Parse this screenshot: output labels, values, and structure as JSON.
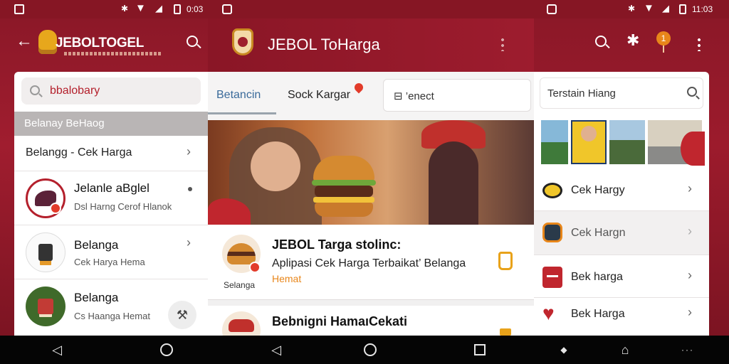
{
  "status": {
    "left_time": "0:03",
    "right_time": "11:03"
  },
  "left": {
    "app_title": "JEBOLTOGEL",
    "search_text": "bbalobary",
    "section_header": "Belanay BeHaog",
    "menu_row": "Belangg - Cek Harga",
    "items": [
      {
        "title": "Jelanle aBglel",
        "subtitle": "Dsl Harng Cerof Hlanok"
      },
      {
        "title": "Belanga",
        "subtitle": "Cek Harya Hema"
      },
      {
        "title": "Belanga",
        "subtitle": "Cs Haanga Hemat"
      }
    ]
  },
  "middle": {
    "app_title": "JEBOL ToHarga",
    "tabs": [
      "Betancin",
      "Sock Kargar"
    ],
    "search_text": "⊟ ’enect",
    "featured": {
      "title": "JEBOL Targa stolinc:",
      "subtitle": "Aplipasi Cek Harga Terbaikat’ Belanga",
      "tag": "Hemat",
      "thumb_label": "Selanga"
    },
    "second_title": "Bebnigni HamaıCekati"
  },
  "right": {
    "search_text": "Terstain Hiang",
    "badge": "1",
    "items": [
      {
        "label": "Cek Hargy"
      },
      {
        "label": "Cek Hargn"
      },
      {
        "label": "Bek harga"
      },
      {
        "label": "Bek Harga"
      }
    ]
  },
  "colors": {
    "brand_red": "#8f1829",
    "accent_orange": "#e8861a",
    "badge_red": "#e23b2a"
  }
}
